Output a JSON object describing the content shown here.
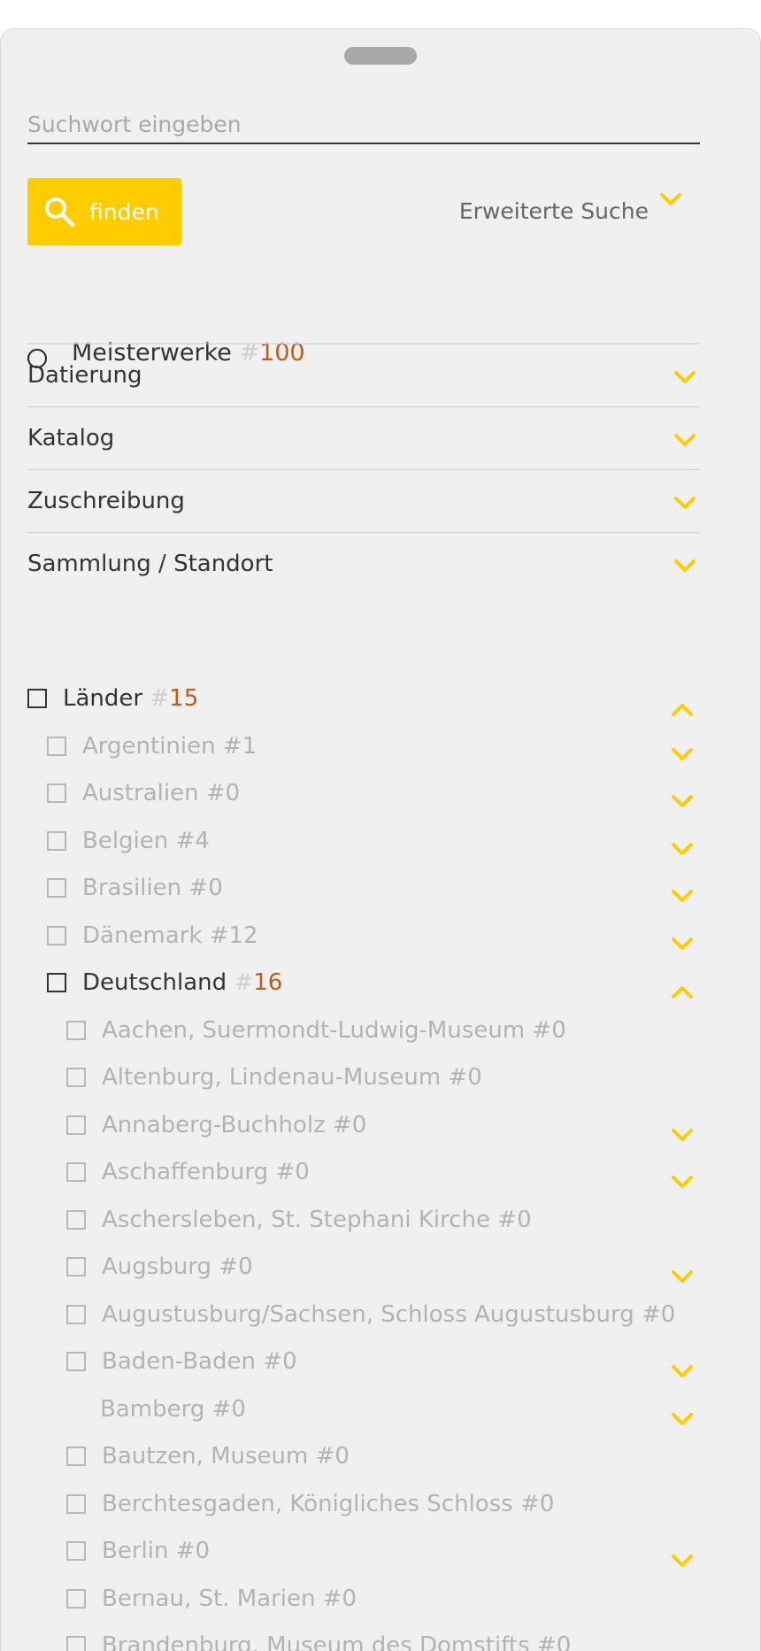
{
  "search": {
    "placeholder": "Suchwort eingeben",
    "value": "",
    "button_label": "finden",
    "advanced_label": "Erweiterte Suche"
  },
  "masterworks": {
    "label": "Meisterwerke",
    "hash": "#",
    "count": "100"
  },
  "sections": [
    {
      "label": "Datierung"
    },
    {
      "label": "Katalog"
    },
    {
      "label": "Zuschreibung"
    },
    {
      "label": "Sammlung / Standort"
    }
  ],
  "tree": {
    "root": {
      "label": "Länder",
      "hash": "#",
      "count": "15"
    },
    "countries": [
      {
        "label": "Argentinien #1"
      },
      {
        "label": "Australien #0"
      },
      {
        "label": "Belgien #4"
      },
      {
        "label": "Brasilien #0"
      },
      {
        "label": "Dänemark #12"
      }
    ],
    "germany": {
      "label": "Deutschland",
      "hash": "#",
      "count": "16"
    },
    "cities": [
      {
        "label": "Aachen, Suermondt-Ludwig-Museum #0"
      },
      {
        "label": "Altenburg, Lindenau-Museum #0"
      },
      {
        "label": "Annaberg-Buchholz #0"
      },
      {
        "label": "Aschaffenburg #0"
      },
      {
        "label": "Aschersleben, St. Stephani Kirche #0"
      },
      {
        "label": "Augsburg #0"
      },
      {
        "label": "Augustusburg/Sachsen, Schloss Augustusburg #0"
      },
      {
        "label": "Baden-Baden #0"
      },
      {
        "label": "Bamberg #0"
      },
      {
        "label": "Bautzen, Museum #0"
      },
      {
        "label": "Berchtesgaden, Königliches Schloss #0"
      },
      {
        "label": "Berlin #0"
      },
      {
        "label": "Bernau, St. Marien #0"
      },
      {
        "label": "Brandenburg, Museum des Domstifts #0"
      }
    ]
  },
  "colors": {
    "accent": "#ffcc00",
    "count": "#c55a11",
    "muted": "#b3b3b3",
    "text": "#333333"
  },
  "icons": {
    "search": "search-icon",
    "expand": "chevron-down-icon",
    "collapse": "chevron-up-icon"
  }
}
